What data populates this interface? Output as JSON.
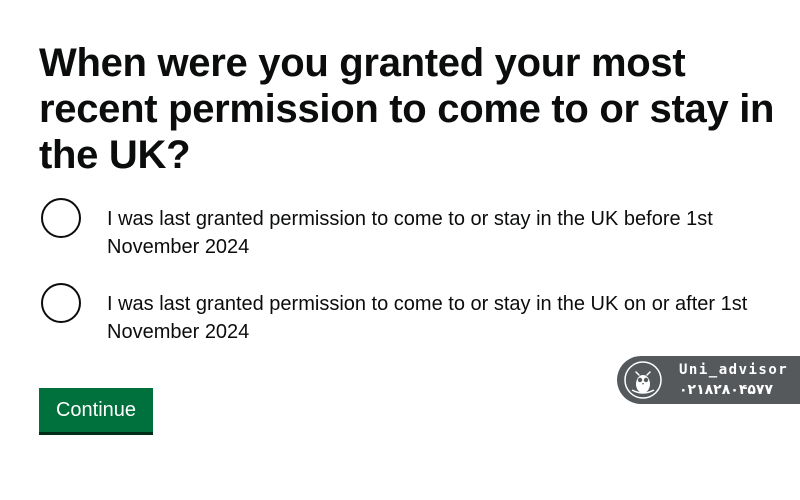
{
  "question": {
    "heading": "When were you granted your most recent permission to come to or stay in the UK?"
  },
  "options": [
    {
      "label": "I was last granted permission to come to or stay in the UK before 1st November 2024",
      "selected": false
    },
    {
      "label": "I was last granted permission to come to or stay in the UK on or after 1st November 2024",
      "selected": false
    }
  ],
  "actions": {
    "continue_label": "Continue"
  },
  "watermark": {
    "name": "Uni_advisor",
    "phone": "۰۲۱۸۲۸۰۴۵۷۷",
    "icon": "owl-logo-icon"
  },
  "colors": {
    "text": "#0b0c0c",
    "button_green": "#00703c",
    "button_shadow": "#002d18",
    "watermark_bg": "#55595c"
  }
}
